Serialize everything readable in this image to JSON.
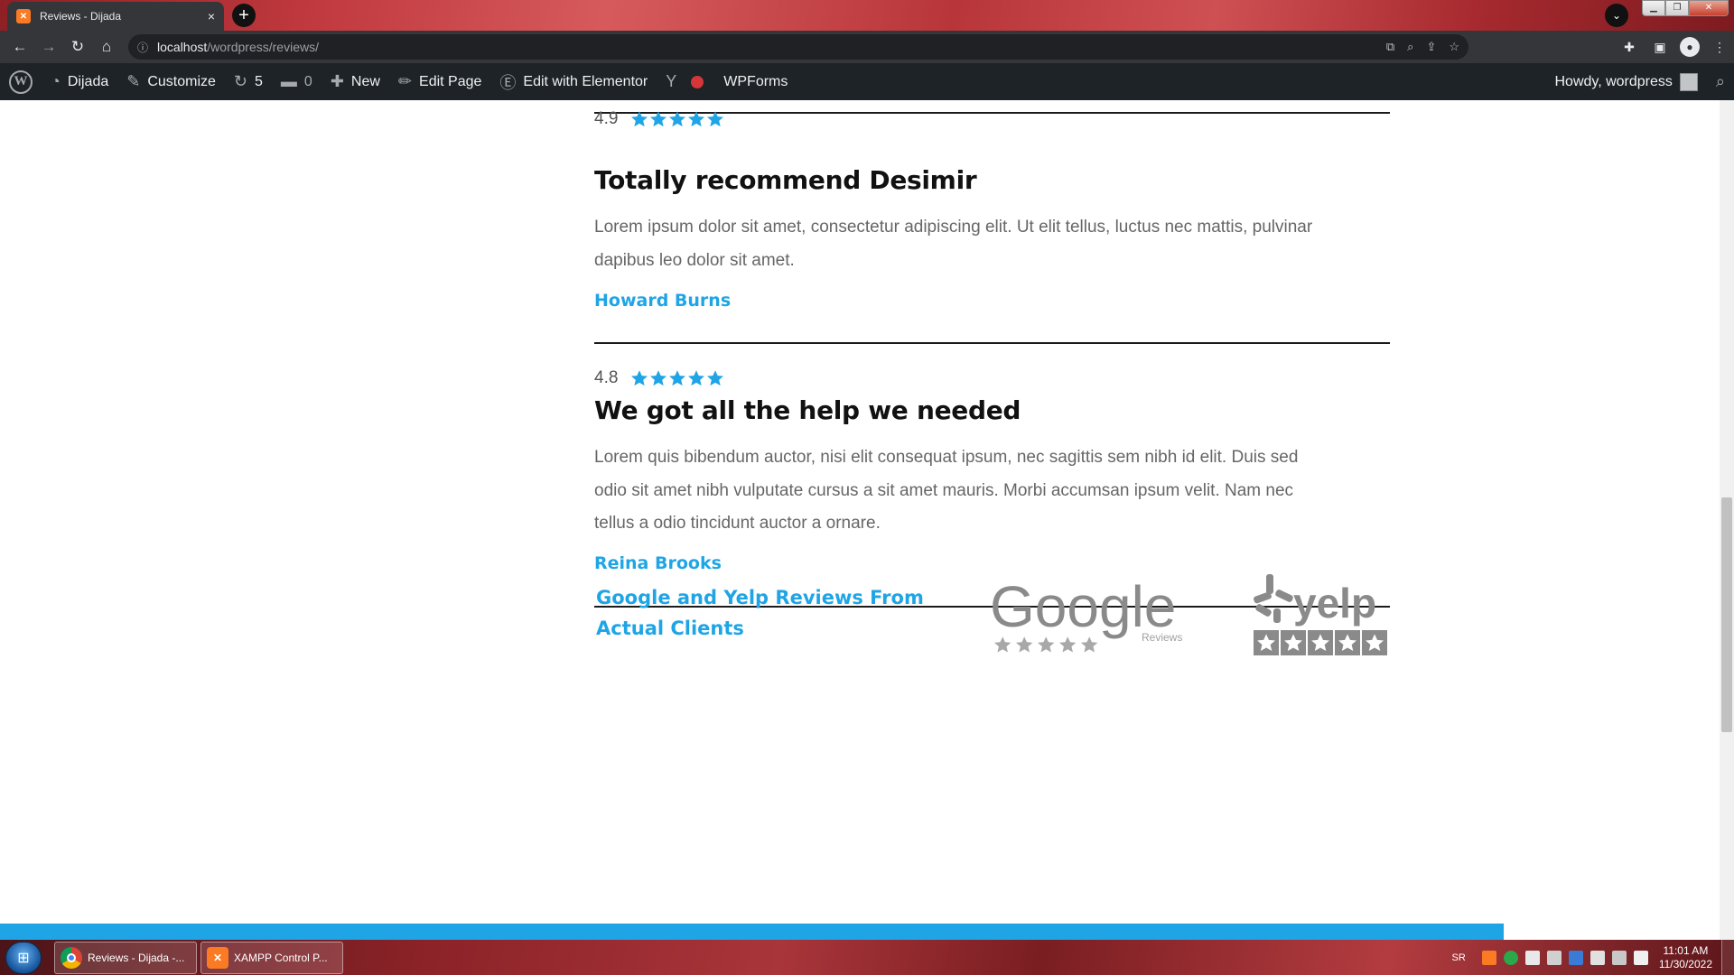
{
  "browser": {
    "tab_title": "Reviews - Dijada",
    "tab_close": "×",
    "new_tab": "+",
    "url_host": "localhost",
    "url_path": "/wordpress/reviews/"
  },
  "adminbar": {
    "site_name": "Dijada",
    "customize": "Customize",
    "updates_count": "5",
    "comments_count": "0",
    "new": "New",
    "edit_page": "Edit Page",
    "edit_elementor": "Edit with Elementor",
    "wpforms": "WPForms",
    "howdy": "Howdy, wordpress"
  },
  "reviews": [
    {
      "rating": "4.9",
      "stars": 5,
      "title": "Totally recommend Desimir",
      "body": "Lorem ipsum dolor sit amet, consectetur adipiscing elit. Ut elit tellus, luctus nec mattis, pulvinar dapibus leo dolor sit amet.",
      "author": "Howard Burns"
    },
    {
      "rating": "4.8",
      "stars": 5,
      "title": "We got all the help we needed",
      "body": "Lorem quis bibendum auctor, nisi elit consequat ipsum, nec sagittis sem nibh id elit. Duis sed odio sit amet nibh vulputate cursus a sit amet mauris. Morbi accumsan ipsum velit. Nam nec tellus a odio tincidunt auctor a ornare.",
      "author": "Reina Brooks"
    }
  ],
  "footer": {
    "heading": "Google and Yelp Reviews From Actual Clients",
    "google_logo_text": "Google",
    "google_logo_sub": "Reviews",
    "yelp_logo_text": "yelp"
  },
  "colors": {
    "accent": "#1fa5e6",
    "adminbar": "#1d2327",
    "heading": "#111111"
  },
  "taskbar": {
    "chrome_item": "Reviews - Dijada -...",
    "xampp_item": "XAMPP Control P...",
    "lang": "SR",
    "time": "11:01 AM",
    "date": "11/30/2022"
  }
}
